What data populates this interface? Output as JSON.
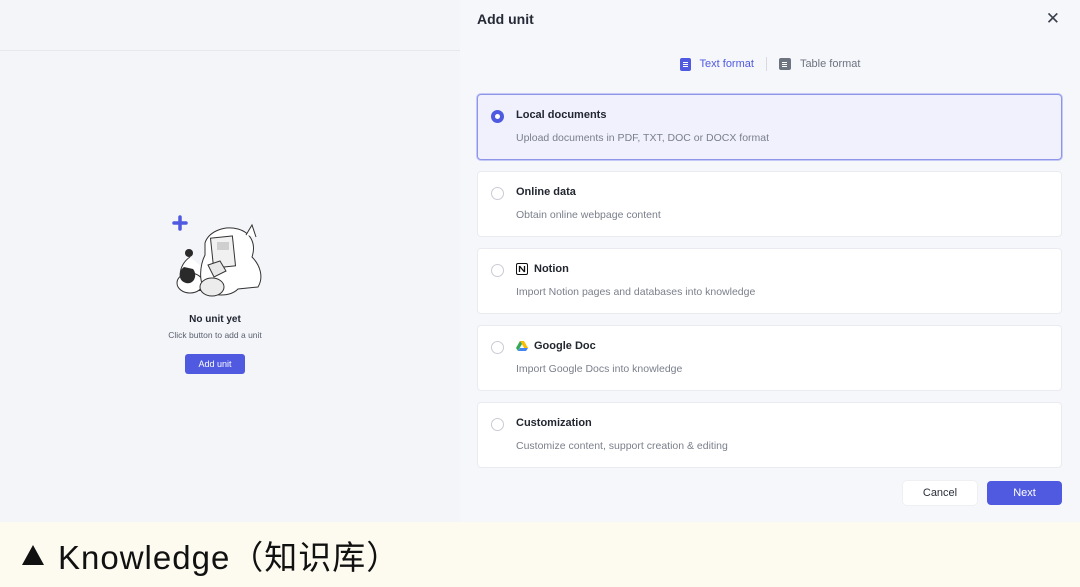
{
  "empty_state": {
    "title": "No unit yet",
    "subtitle": "Click button to add a unit",
    "button_label": "Add unit"
  },
  "modal": {
    "title": "Add unit",
    "close_icon": "close-icon",
    "tabs": [
      {
        "label": "Text format",
        "active": true,
        "icon": "text-format-icon"
      },
      {
        "label": "Table format",
        "active": false,
        "icon": "table-format-icon"
      }
    ],
    "options": [
      {
        "title": "Local documents",
        "description": "Upload documents in PDF, TXT, DOC or DOCX format",
        "selected": true
      },
      {
        "title": "Online data",
        "description": "Obtain online webpage content",
        "selected": false
      },
      {
        "title": "Notion",
        "description": "Import Notion pages and databases into knowledge",
        "selected": false,
        "icon": "notion-icon"
      },
      {
        "title": "Google Doc",
        "description": "Import Google Docs into knowledge",
        "selected": false,
        "icon": "google-drive-icon"
      },
      {
        "title": "Customization",
        "description": "Customize content, support creation & editing",
        "selected": false
      }
    ],
    "cancel_label": "Cancel",
    "next_label": "Next"
  },
  "caption": "Knowledge（知识库）",
  "colors": {
    "accent": "#4f5ae0",
    "background": "#f4f5f9",
    "caption_bg": "#fdfbf0"
  }
}
